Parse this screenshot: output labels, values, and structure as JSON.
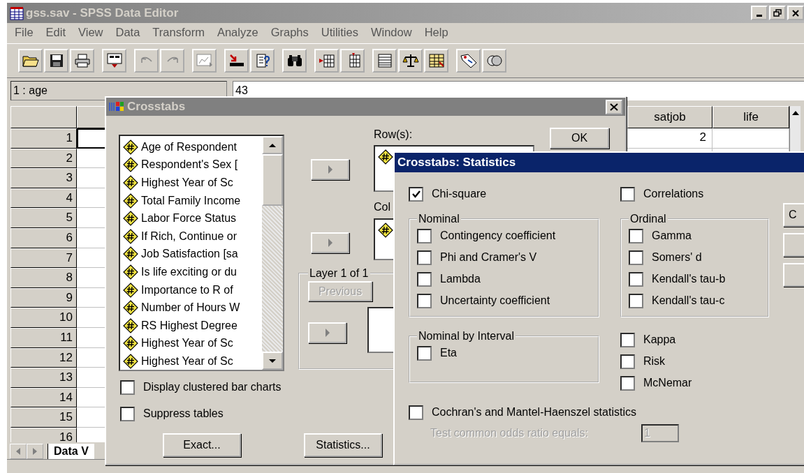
{
  "window": {
    "title": "gss.sav - SPSS Data Editor"
  },
  "menu": [
    "File",
    "Edit",
    "View",
    "Data",
    "Transform",
    "Analyze",
    "Graphs",
    "Utilities",
    "Window",
    "Help"
  ],
  "cell_bar": {
    "reference": "1 : age",
    "value": "43"
  },
  "grid": {
    "columns": [
      "satjob",
      "life"
    ],
    "rows": [
      {
        "number": "1",
        "selected": true,
        "cells": [
          "2"
        ]
      },
      {
        "number": "2",
        "selected": false
      },
      {
        "number": "3",
        "selected": false
      },
      {
        "number": "4",
        "selected": false
      },
      {
        "number": "5",
        "selected": false
      },
      {
        "number": "6",
        "selected": false
      },
      {
        "number": "7",
        "selected": false
      },
      {
        "number": "8",
        "selected": false
      },
      {
        "number": "9",
        "selected": false
      },
      {
        "number": "10",
        "selected": false
      },
      {
        "number": "11",
        "selected": false
      },
      {
        "number": "12",
        "selected": false
      },
      {
        "number": "13",
        "selected": false
      },
      {
        "number": "14",
        "selected": false
      },
      {
        "number": "15",
        "selected": false
      },
      {
        "number": "16",
        "selected": false
      }
    ]
  },
  "sheet_tabs": [
    {
      "label": "Data V",
      "selected": true
    }
  ],
  "crosstabs": {
    "title": "Crosstabs",
    "variables": [
      "Age of Respondent",
      "Respondent's Sex [",
      "Highest Year of Sc",
      "Total Family Income",
      "Labor Force Status",
      "If Rich, Continue or",
      "Job Satisfaction [sa",
      "Is life exciting or du",
      "Importance to R of",
      "Number of Hours W",
      "RS Highest Degree",
      "Highest Year of Sc",
      "Highest Year of Sc"
    ],
    "row_label": "Row(s):",
    "column_label": "Col",
    "layer_label": "Layer 1 of 1",
    "previous_button": {
      "label": "Previous",
      "disabled": true
    },
    "ok_button": "OK",
    "options": [
      {
        "label": "Display clustered bar charts",
        "checked": false
      },
      {
        "label": "Suppress tables",
        "checked": false
      }
    ],
    "buttons": [
      "Exact...",
      "Statistics..."
    ]
  },
  "statistics": {
    "title": "Crosstabs: Statistics",
    "top": [
      {
        "label": "Chi-square",
        "checked": true
      },
      {
        "label": "Correlations",
        "checked": false
      }
    ],
    "nominal": {
      "title": "Nominal",
      "items": [
        {
          "label": "Contingency coefficient",
          "checked": false
        },
        {
          "label": "Phi and Cramer's V",
          "checked": false
        },
        {
          "label": "Lambda",
          "checked": false
        },
        {
          "label": "Uncertainty coefficient",
          "checked": false
        }
      ]
    },
    "ordinal": {
      "title": "Ordinal",
      "items": [
        {
          "label": "Gamma",
          "checked": false
        },
        {
          "label": "Somers' d",
          "checked": false
        },
        {
          "label": "Kendall's tau-b",
          "checked": false
        },
        {
          "label": "Kendall's tau-c",
          "checked": false
        }
      ]
    },
    "nominal_by_interval": {
      "title": "Nominal by Interval",
      "items": [
        {
          "label": "Eta",
          "checked": false
        }
      ]
    },
    "other": [
      {
        "label": "Kappa",
        "checked": false
      },
      {
        "label": "Risk",
        "checked": false
      },
      {
        "label": "McNemar",
        "checked": false
      }
    ],
    "cochran": {
      "label": "Cochran's and Mantel-Haenszel statistics",
      "checked": false
    },
    "odds_ratio": {
      "label": "Test common odds ratio equals:",
      "value": "1",
      "disabled": true
    },
    "side_buttons": [
      "C"
    ]
  }
}
